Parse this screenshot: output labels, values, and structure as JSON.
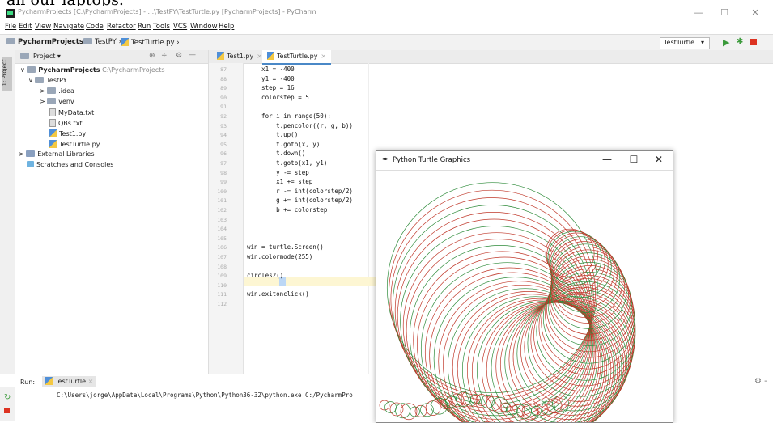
{
  "caption": "all our laptops.",
  "window": {
    "title": "PycharmProjects [C:\\PycharmProjects] - ...\\TestPY\\TestTurtle.py [PycharmProjects] - PyCharm",
    "minimize": "—",
    "maximize": "☐",
    "close": "✕"
  },
  "menu": [
    "File",
    "Edit",
    "View",
    "Navigate",
    "Code",
    "Refactor",
    "Run",
    "Tools",
    "VCS",
    "Window",
    "Help"
  ],
  "breadcrumbs": [
    "PycharmProjects",
    "TestPY",
    "TestTurtle.py"
  ],
  "toolbar": {
    "run_config": "TestTurtle",
    "dropdown": "▾",
    "run": "▶",
    "debug": "✱"
  },
  "sidebar": {
    "strip_label": "1: Project",
    "header": "Project",
    "header_dropdown": "▾",
    "header_icons": [
      "⊕",
      "÷",
      "⚙",
      "—"
    ]
  },
  "tree": [
    {
      "arrow": "∨",
      "name": "PycharmProjects",
      "path": "C:\\PycharmProjects",
      "type": "folder"
    },
    {
      "arrow": "∨",
      "name": "TestPY",
      "type": "folder"
    },
    {
      "arrow": ">",
      "name": ".idea",
      "type": "folder"
    },
    {
      "arrow": ">",
      "name": "venv",
      "type": "folder"
    },
    {
      "arrow": "",
      "name": "MyData.txt",
      "type": "txt"
    },
    {
      "arrow": "",
      "name": "QBs.txt",
      "type": "txt"
    },
    {
      "arrow": "",
      "name": "Test1.py",
      "type": "py"
    },
    {
      "arrow": "",
      "name": "TestTurtle.py",
      "type": "py"
    },
    {
      "arrow": ">",
      "name": "External Libraries",
      "type": "lib"
    },
    {
      "arrow": "",
      "name": "Scratches and Consoles",
      "type": "scratch"
    }
  ],
  "tabs": [
    {
      "label": "Test1.py",
      "close": "×"
    },
    {
      "label": "TestTurtle.py",
      "close": "×"
    }
  ],
  "code_lines": [
    {
      "n": "87",
      "text": "    x1 = -400"
    },
    {
      "n": "88",
      "text": "    y1 = -400"
    },
    {
      "n": "89",
      "text": "    step = 16"
    },
    {
      "n": "90",
      "text": "    colorstep = 5"
    },
    {
      "n": "91",
      "text": ""
    },
    {
      "n": "92",
      "text": "    for i in range(50):"
    },
    {
      "n": "93",
      "text": "        t.pencolor((r, g, b))"
    },
    {
      "n": "94",
      "text": "        t.up()"
    },
    {
      "n": "95",
      "text": "        t.goto(x, y)"
    },
    {
      "n": "96",
      "text": "        t.down()"
    },
    {
      "n": "97",
      "text": "        t.goto(x1, y1)"
    },
    {
      "n": "98",
      "text": "        y -= step"
    },
    {
      "n": "99",
      "text": "        x1 += step"
    },
    {
      "n": "100",
      "text": "        r -= int(colorstep/2)"
    },
    {
      "n": "101",
      "text": "        g += int(colorstep/2)"
    },
    {
      "n": "102",
      "text": "        b += colorstep"
    },
    {
      "n": "103",
      "text": ""
    },
    {
      "n": "104",
      "text": ""
    },
    {
      "n": "105",
      "text": ""
    },
    {
      "n": "106",
      "text": "win = turtle.Screen()"
    },
    {
      "n": "107",
      "text": "win.colormode(255)"
    },
    {
      "n": "108",
      "text": ""
    },
    {
      "n": "109",
      "text": "circles2()"
    },
    {
      "n": "110",
      "text": ""
    },
    {
      "n": "111",
      "text": "win.exitonclick()"
    },
    {
      "n": "112",
      "text": ""
    }
  ],
  "run_panel": {
    "label": "Run:",
    "tab": "TestTurtle",
    "tab_close": "×",
    "command": "C:\\Users\\jorge\\AppData\\Local\\Programs\\Python\\Python36-32\\python.exe C:/PycharmPro",
    "gear": "⚙ -"
  },
  "turtle_window": {
    "title": "Python Turtle Graphics",
    "minimize": "—",
    "maximize": "☐",
    "close": "✕"
  },
  "colors": {
    "accent": "#4a88c7",
    "circle_red": "#c0392b",
    "circle_green": "#2e8b3a",
    "run_green": "#3a9a3a"
  }
}
